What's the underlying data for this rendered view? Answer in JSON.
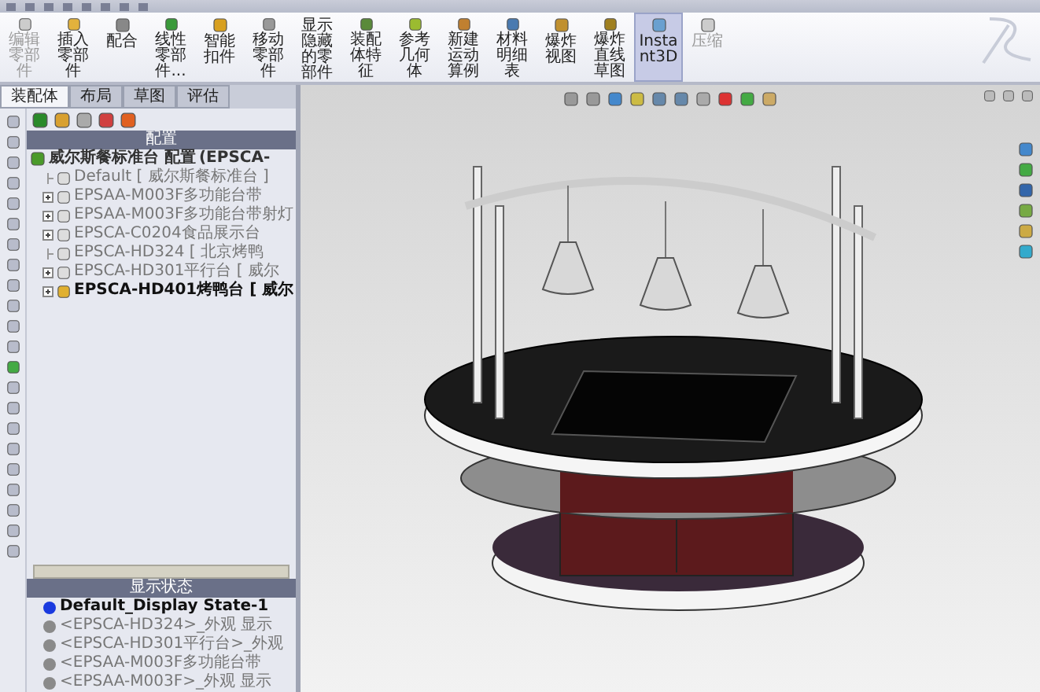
{
  "ribbon": {
    "buttons": [
      {
        "label": "编辑零部件",
        "disabled": true,
        "selected": false
      },
      {
        "label": "插入零部件",
        "disabled": false,
        "selected": false
      },
      {
        "label": "配合",
        "disabled": false,
        "selected": false
      },
      {
        "label": "线性零部件...",
        "disabled": false,
        "selected": false
      },
      {
        "label": "智能扣件",
        "disabled": false,
        "selected": false
      },
      {
        "label": "移动零部件",
        "disabled": false,
        "selected": false
      },
      {
        "label": "显示隐藏的零部件",
        "disabled": false,
        "selected": false
      },
      {
        "label": "装配体特征",
        "disabled": false,
        "selected": false
      },
      {
        "label": "参考几何体",
        "disabled": false,
        "selected": false
      },
      {
        "label": "新建运动算例",
        "disabled": false,
        "selected": false
      },
      {
        "label": "材料明细表",
        "disabled": false,
        "selected": false
      },
      {
        "label": "爆炸视图",
        "disabled": false,
        "selected": false
      },
      {
        "label": "爆炸直线草图",
        "disabled": false,
        "selected": false
      },
      {
        "label": "Instant3D",
        "disabled": false,
        "selected": true
      },
      {
        "label": "压缩",
        "disabled": true,
        "selected": false
      }
    ]
  },
  "tabs": [
    {
      "label": "装配体",
      "selected": true
    },
    {
      "label": "布局",
      "selected": false
    },
    {
      "label": "草图",
      "selected": false
    },
    {
      "label": "评估",
      "selected": false
    }
  ],
  "config_panel": {
    "title": "配置",
    "root": {
      "label": "威尔斯餐标准台 配置",
      "note": "(EPSCA-",
      "children": [
        {
          "label": "Default [ 威尔斯餐标准台 ]",
          "expandable": false,
          "active": false
        },
        {
          "label": "EPSAA-M003F多功能台带",
          "expandable": true,
          "active": false
        },
        {
          "label": "EPSAA-M003F多功能台带射灯",
          "expandable": true,
          "active": false
        },
        {
          "label": "EPSCA-C0204食品展示台",
          "expandable": true,
          "active": false
        },
        {
          "label": "EPSCA-HD324 [ 北京烤鸭",
          "expandable": false,
          "active": false
        },
        {
          "label": "EPSCA-HD301平行台 [ 威尔",
          "expandable": true,
          "active": false
        },
        {
          "label": "EPSCA-HD401烤鸭台 [ 威尔",
          "expandable": true,
          "active": true
        }
      ]
    }
  },
  "display_states": {
    "title": "显示状态",
    "items": [
      {
        "label": "Default_Display State-1",
        "selected": true
      },
      {
        "label": "<EPSCA-HD324>_外观 显示",
        "selected": false
      },
      {
        "label": "<EPSCA-HD301平行台>_外观",
        "selected": false
      },
      {
        "label": "<EPSAA-M003F多功能台带",
        "selected": false
      },
      {
        "label": "<EPSAA-M003F>_外观 显示",
        "selected": false
      }
    ]
  }
}
